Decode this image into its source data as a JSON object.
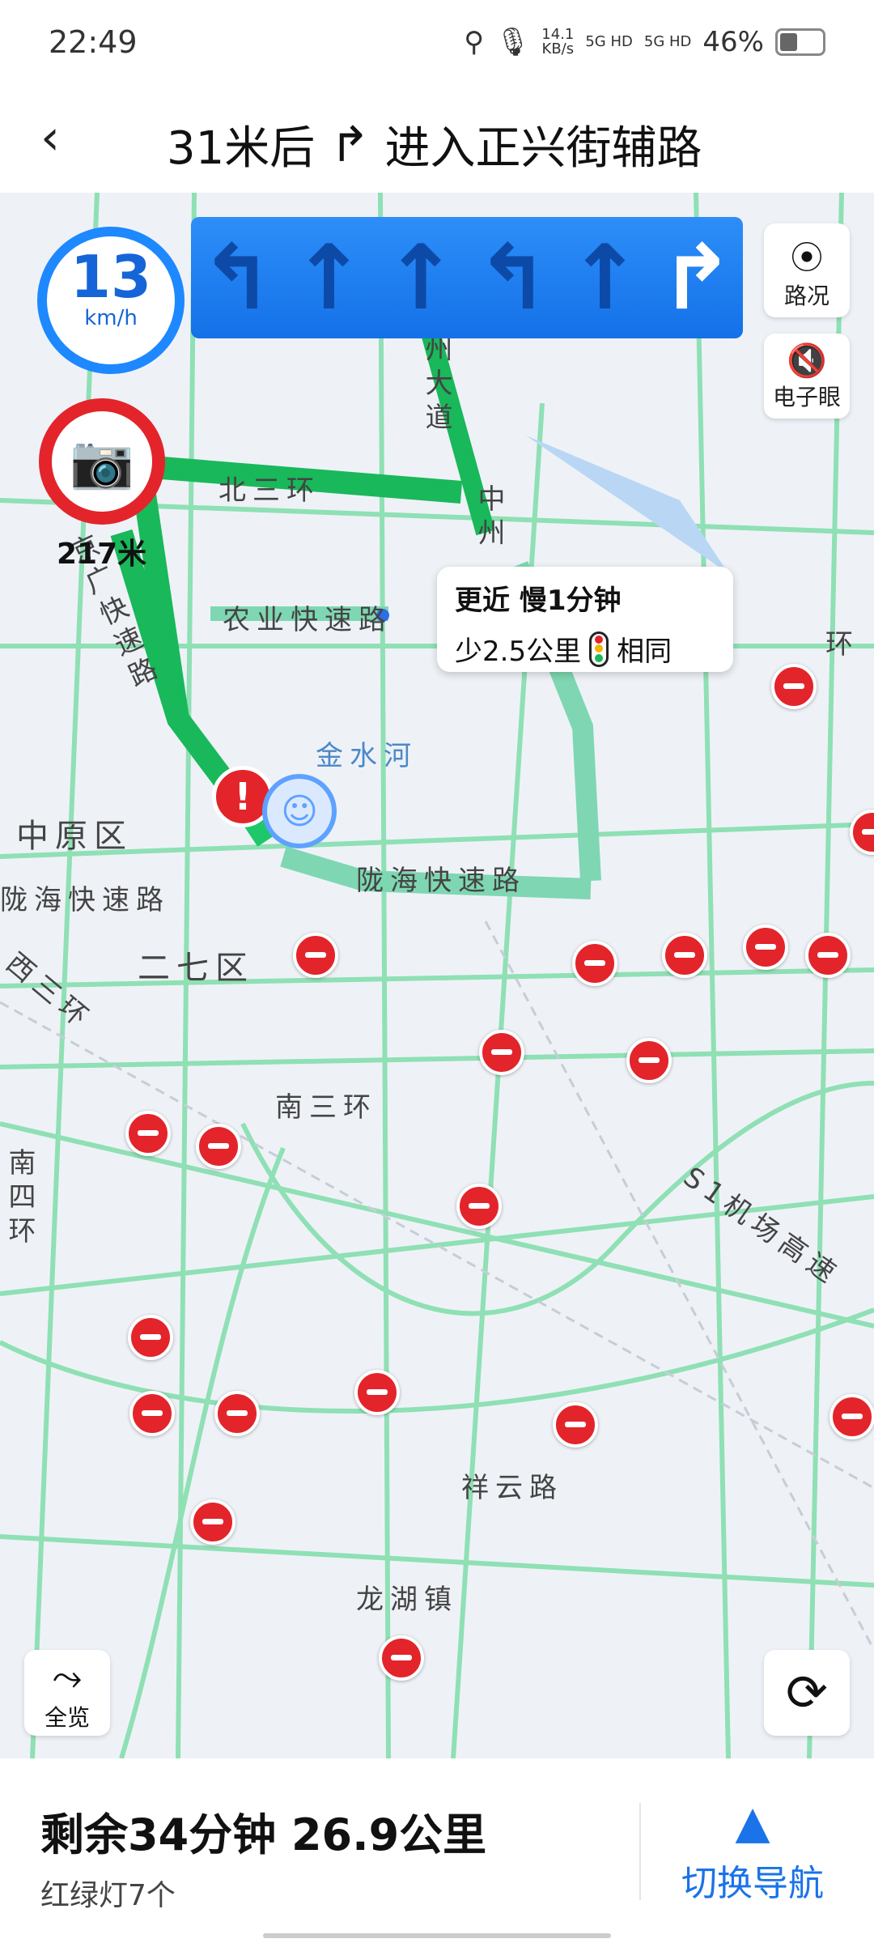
{
  "status_bar": {
    "time": "22:49",
    "net_speed": "14.1",
    "net_unit": "KB/s",
    "sim1": "5G HD",
    "sim2": "5G HD",
    "battery": "46%",
    "battery_level": 0.46
  },
  "nav": {
    "back_icon": "chevron-left-icon",
    "distance": "31米后",
    "turn_icon": "turn-right-icon",
    "action": "进入正兴街辅路"
  },
  "speed": {
    "value": "13",
    "unit": "km/h"
  },
  "lanes": [
    {
      "icon": "turn-left-arrow-icon",
      "active": false
    },
    {
      "icon": "straight-arrow-icon",
      "active": false
    },
    {
      "icon": "straight-arrow-icon",
      "active": false
    },
    {
      "icon": "turn-left-arrow-icon",
      "active": false
    },
    {
      "icon": "straight-arrow-icon",
      "active": false
    },
    {
      "icon": "turn-right-arrow-icon",
      "active": true
    }
  ],
  "side_buttons": {
    "traffic": "路况",
    "camera": "电子眼"
  },
  "camera": {
    "distance": "217米"
  },
  "callout": {
    "title": "更近 慢1分钟",
    "distance": "少2.5公里",
    "lights": "相同"
  },
  "map_labels": {
    "north_ring": "北三环",
    "zhongzhou": "州大道",
    "zhongzhou2": "中州",
    "agri_expressway": "农业快速路",
    "jingguang": "京广快速路",
    "jinshui": "金水河",
    "zhongyuan": "中原区",
    "longhai_exp": "陇海快速路",
    "longhai_exp2": "陇海快速路",
    "erqi": "二七区",
    "west_ring": "西三环",
    "south_ring": "南三环",
    "south_four_ring": "南四环",
    "airport": "S1机场高速",
    "xiangyun": "祥云路",
    "longhu": "龙湖镇",
    "ring_label": "环"
  },
  "bottom_buttons": {
    "overview": "全览",
    "refresh_icon": "refresh-icon"
  },
  "footer": {
    "remaining": "剩余34分钟  26.9公里",
    "lights": "红绿灯7个",
    "switch": "切换导航"
  }
}
